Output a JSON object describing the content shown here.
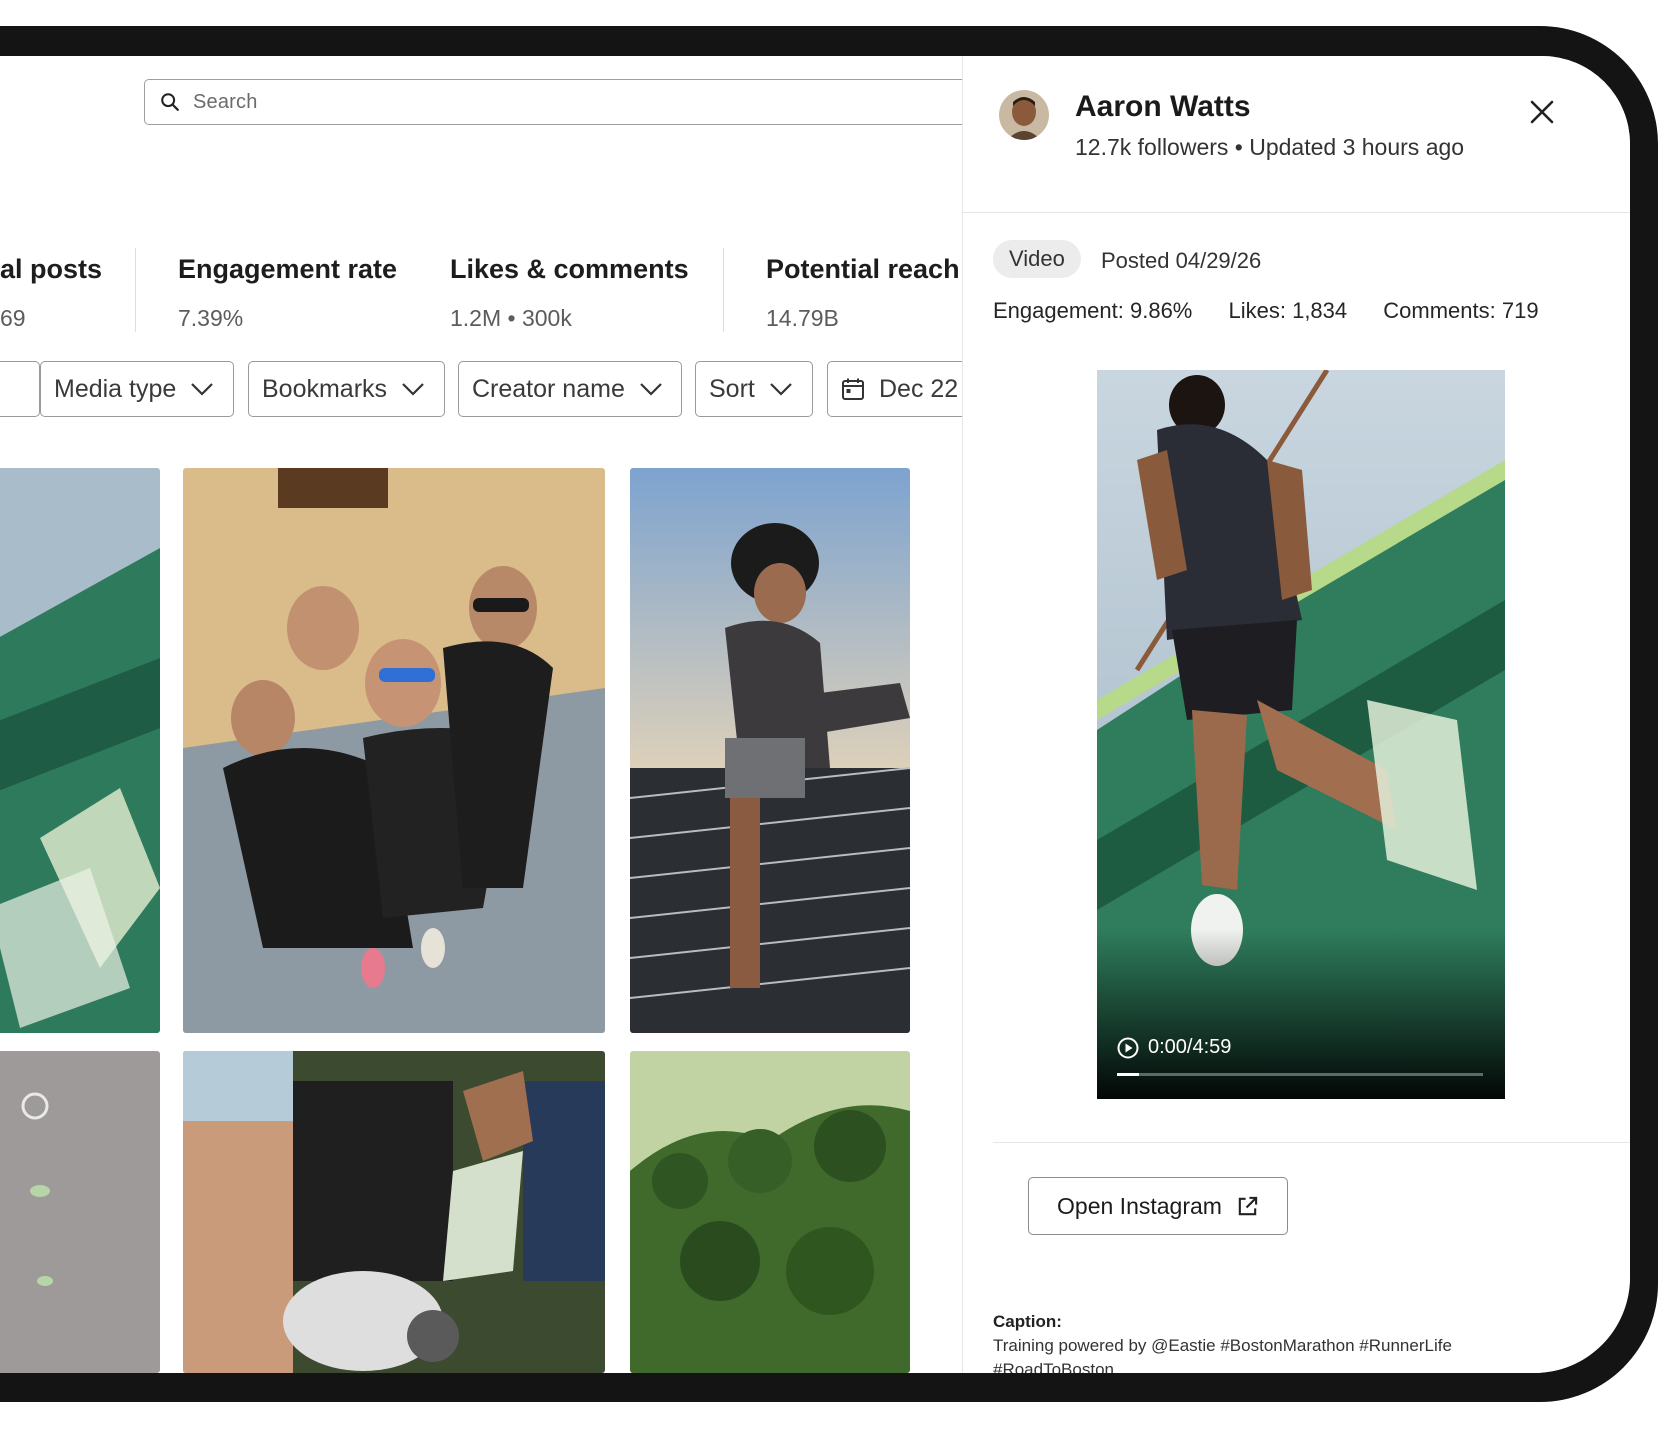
{
  "search": {
    "placeholder": "Search"
  },
  "stats": [
    {
      "title": "al posts",
      "value": "69"
    },
    {
      "title": "Engagement rate",
      "value": "7.39%"
    },
    {
      "title": "Likes & comments",
      "value": "1.2M • 300k"
    },
    {
      "title": "Potential reach",
      "value": "14.79B"
    }
  ],
  "filters": [
    {
      "label": "Media type"
    },
    {
      "label": "Bookmarks"
    },
    {
      "label": "Creator name"
    },
    {
      "label": "Sort"
    },
    {
      "label": "Dec 22"
    }
  ],
  "panel": {
    "name": "Aaron Watts",
    "meta": "12.7k followers • Updated 3 hours ago",
    "badge": "Video",
    "posted": "Posted 04/29/26",
    "engagement": "Engagement: 9.86%",
    "likes": "Likes: 1,834",
    "comments": "Comments: 719",
    "video_time": "0:00/4:59",
    "video_progress": 0.06,
    "open_button": "Open Instagram",
    "caption_label": "Caption:",
    "caption": "Training powered by @Eastie #BostonMarathon #RunnerLife #RoadToBoston"
  },
  "icons": [
    "search-icon",
    "chevron-down-icon",
    "calendar-icon",
    "close-icon",
    "play-icon",
    "external-link-icon"
  ]
}
